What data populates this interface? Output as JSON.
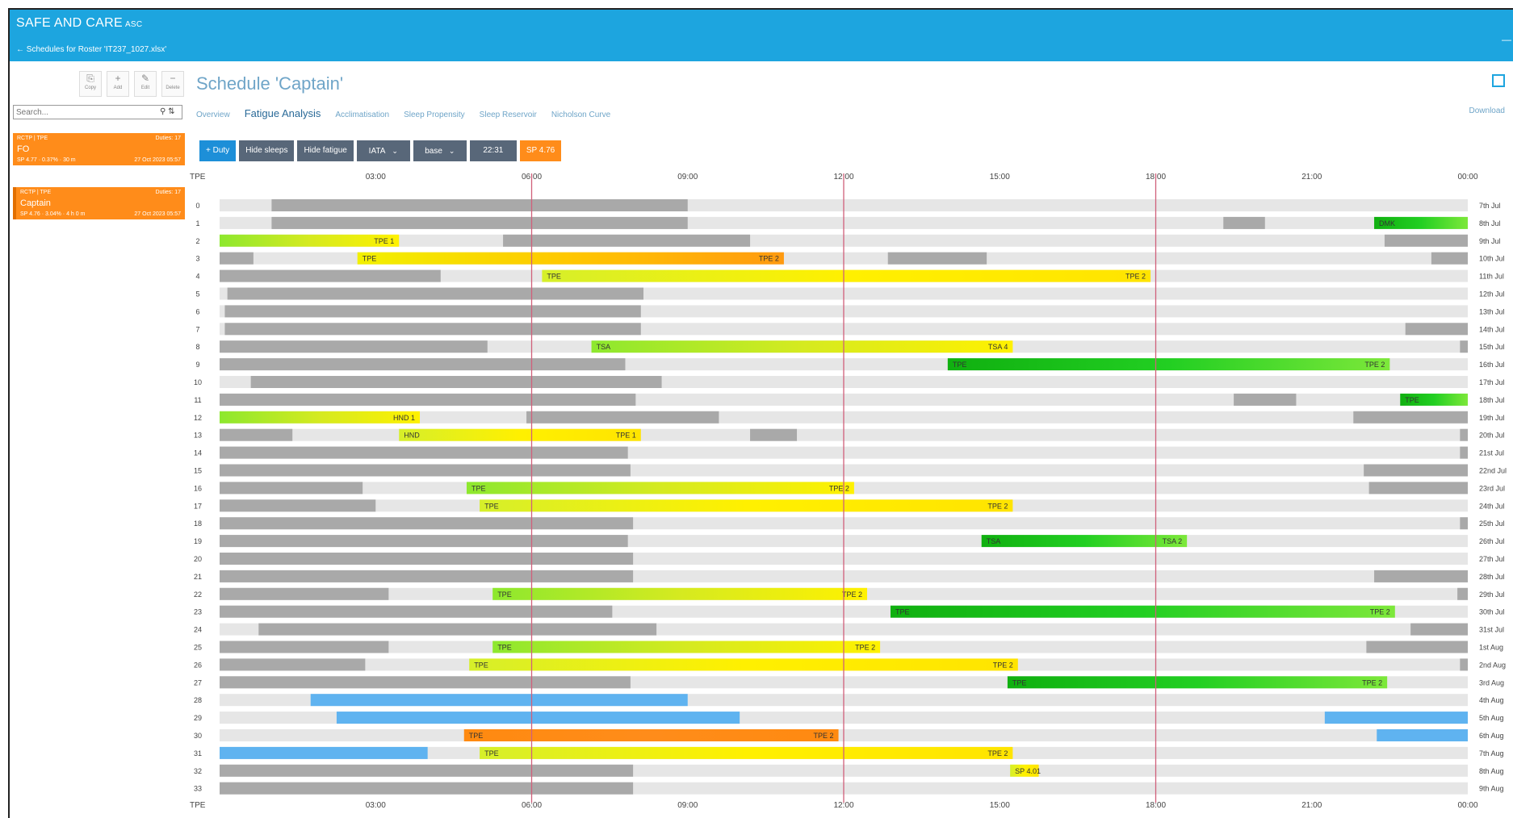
{
  "app": {
    "brand": "SAFE AND CARE",
    "brand_suffix": "ASC",
    "back_link": "← Schedules for Roster 'IT237_1027.xlsx'",
    "corner_mark": "—"
  },
  "toolbar": [
    {
      "icon": "copy-icon",
      "glyph": "⎘",
      "label": "Copy"
    },
    {
      "icon": "add-icon",
      "glyph": "+",
      "label": "Add"
    },
    {
      "icon": "edit-icon",
      "glyph": "✎",
      "label": "Edit"
    },
    {
      "icon": "delete-icon",
      "glyph": "−",
      "label": "Delete"
    }
  ],
  "search": {
    "placeholder": "Search...",
    "icon": "search-icon",
    "sort_icon": "sort-icon"
  },
  "schedules": [
    {
      "code": "RCTP | TPE",
      "duties": "Duties: 17",
      "name": "FO",
      "stats": "SP 4.77 · 0.37% · 30 m",
      "date": "27 Oct 2023 05:57"
    },
    {
      "code": "RCTP | TPE",
      "duties": "Duties: 17",
      "name": "Captain",
      "stats": "SP 4.76 · 3.04% · 4 h 0 m",
      "date": "27 Oct 2023 05:57"
    }
  ],
  "page": {
    "title": "Schedule 'Captain'",
    "download": "Download"
  },
  "tabs": [
    "Overview",
    "Fatigue Analysis",
    "Acclimatisation",
    "Sleep Propensity",
    "Sleep Reservoir",
    "Nicholson Curve"
  ],
  "controls": {
    "duty": "+ Duty",
    "hide_sleeps": "Hide sleeps",
    "hide_fatigue": "Hide fatigue",
    "iata": "IATA",
    "base": "base",
    "time": "22:31",
    "sp": "SP 4.76"
  },
  "axis": {
    "tz_label": "TPE",
    "ticks": [
      "03:00",
      "06:00",
      "09:00",
      "12:00",
      "15:00",
      "18:00",
      "21:00",
      "00:00"
    ]
  },
  "colors": {
    "brand": "#1da5df",
    "accent": "#ff8c1a",
    "sleep": "#a9a9a9",
    "rest": "#5fb3f0",
    "lane": "#e6e6e6",
    "marker": "#d0607a"
  },
  "markers_hours": [
    6,
    12,
    18
  ],
  "rows": [
    {
      "num": "0",
      "date": "7th Jul",
      "sleeps": [
        [
          1,
          9
        ]
      ],
      "duties": []
    },
    {
      "num": "1",
      "date": "8th Jul",
      "sleeps": [
        [
          1,
          9
        ],
        [
          19.3,
          20.1
        ]
      ],
      "duties": [
        {
          "s": 22.2,
          "e": 24,
          "g": "green",
          "l1": "DMK",
          "l2": ""
        }
      ]
    },
    {
      "num": "2",
      "date": "9th Jul",
      "sleeps": [
        [
          5.45,
          10.2
        ],
        [
          22.4,
          24
        ]
      ],
      "duties": [
        {
          "s": 0,
          "e": 3.45,
          "g": "gy",
          "l1": "",
          "l2": "TPE 1"
        }
      ]
    },
    {
      "num": "3",
      "date": "10th Jul",
      "sleeps": [
        [
          0,
          0.65
        ],
        [
          12.85,
          14.75
        ],
        [
          23.3,
          24
        ]
      ],
      "duties": [
        {
          "s": 2.65,
          "e": 10.85,
          "g": "yo",
          "l1": "TPE",
          "l2": "TPE 2"
        }
      ]
    },
    {
      "num": "4",
      "date": "11th Jul",
      "sleeps": [
        [
          0,
          4.25
        ]
      ],
      "duties": [
        {
          "s": 6.2,
          "e": 17.9,
          "g": "yellow",
          "l1": "TPE",
          "l2": "TPE 2"
        }
      ]
    },
    {
      "num": "5",
      "date": "12th Jul",
      "sleeps": [
        [
          0.15,
          8.15
        ]
      ],
      "duties": []
    },
    {
      "num": "6",
      "date": "13th Jul",
      "sleeps": [
        [
          0.1,
          8.1
        ]
      ],
      "duties": []
    },
    {
      "num": "7",
      "date": "14th Jul",
      "sleeps": [
        [
          0.1,
          8.1
        ],
        [
          22.8,
          24
        ]
      ],
      "duties": []
    },
    {
      "num": "8",
      "date": "15th Jul",
      "sleeps": [
        [
          0,
          5.15
        ],
        [
          23.85,
          24
        ]
      ],
      "duties": [
        {
          "s": 7.15,
          "e": 15.25,
          "g": "gy",
          "l1": "TSA",
          "l2": "TSA 4"
        }
      ]
    },
    {
      "num": "9",
      "date": "16th Jul",
      "sleeps": [
        [
          0,
          7.8
        ]
      ],
      "duties": [
        {
          "s": 14,
          "e": 22.5,
          "g": "green",
          "l1": "TPE",
          "l2": "TPE 2"
        }
      ]
    },
    {
      "num": "10",
      "date": "17th Jul",
      "sleeps": [
        [
          0.6,
          8.5
        ]
      ],
      "duties": []
    },
    {
      "num": "11",
      "date": "18th Jul",
      "sleeps": [
        [
          0,
          8
        ],
        [
          19.5,
          20.7
        ]
      ],
      "duties": [
        {
          "s": 22.7,
          "e": 24,
          "g": "green",
          "l1": "TPE",
          "l2": ""
        }
      ]
    },
    {
      "num": "12",
      "date": "19th Jul",
      "sleeps": [
        [
          5.9,
          9.6
        ],
        [
          21.8,
          24
        ]
      ],
      "duties": [
        {
          "s": 0,
          "e": 3.85,
          "g": "gy",
          "l1": "",
          "l2": "HND 1"
        }
      ]
    },
    {
      "num": "13",
      "date": "20th Jul",
      "sleeps": [
        [
          0,
          1.4
        ],
        [
          10.2,
          11.1
        ],
        [
          23.85,
          24
        ]
      ],
      "duties": [
        {
          "s": 3.45,
          "e": 8.1,
          "g": "yellow",
          "l1": "HND",
          "l2": "TPE 1"
        }
      ]
    },
    {
      "num": "14",
      "date": "21st Jul",
      "sleeps": [
        [
          0,
          7.85
        ],
        [
          23.85,
          24
        ]
      ],
      "duties": []
    },
    {
      "num": "15",
      "date": "22nd Jul",
      "sleeps": [
        [
          0,
          7.9
        ],
        [
          22,
          24
        ]
      ],
      "duties": []
    },
    {
      "num": "16",
      "date": "23rd Jul",
      "sleeps": [
        [
          0,
          2.75
        ],
        [
          22.1,
          24
        ]
      ],
      "duties": [
        {
          "s": 4.75,
          "e": 12.2,
          "g": "gy",
          "l1": "TPE",
          "l2": "TPE 2"
        }
      ]
    },
    {
      "num": "17",
      "date": "24th Jul",
      "sleeps": [
        [
          0,
          3
        ]
      ],
      "duties": [
        {
          "s": 5,
          "e": 15.25,
          "g": "yellow",
          "l1": "TPE",
          "l2": "TPE 2"
        }
      ]
    },
    {
      "num": "18",
      "date": "25th Jul",
      "sleeps": [
        [
          0,
          7.95
        ],
        [
          23.85,
          24
        ]
      ],
      "duties": []
    },
    {
      "num": "19",
      "date": "26th Jul",
      "sleeps": [
        [
          0,
          7.85
        ]
      ],
      "duties": [
        {
          "s": 14.65,
          "e": 18.6,
          "g": "green",
          "l1": "TSA",
          "l2": "TSA 2"
        }
      ]
    },
    {
      "num": "20",
      "date": "27th Jul",
      "sleeps": [
        [
          0,
          7.95
        ]
      ],
      "duties": []
    },
    {
      "num": "21",
      "date": "28th Jul",
      "sleeps": [
        [
          0,
          7.95
        ],
        [
          22.2,
          24
        ]
      ],
      "duties": []
    },
    {
      "num": "22",
      "date": "29th Jul",
      "sleeps": [
        [
          0,
          3.25
        ],
        [
          23.8,
          24
        ]
      ],
      "duties": [
        {
          "s": 5.25,
          "e": 12.45,
          "g": "gy",
          "l1": "TPE",
          "l2": "TPE 2"
        }
      ]
    },
    {
      "num": "23",
      "date": "30th Jul",
      "sleeps": [
        [
          0,
          7.55
        ]
      ],
      "duties": [
        {
          "s": 12.9,
          "e": 22.6,
          "g": "green",
          "l1": "TPE",
          "l2": "TPE 2"
        }
      ]
    },
    {
      "num": "24",
      "date": "31st Jul",
      "sleeps": [
        [
          0.75,
          8.4
        ],
        [
          22.9,
          24
        ]
      ],
      "duties": []
    },
    {
      "num": "25",
      "date": "1st Aug",
      "sleeps": [
        [
          0,
          3.25
        ],
        [
          22.05,
          24
        ]
      ],
      "duties": [
        {
          "s": 5.25,
          "e": 12.7,
          "g": "gy",
          "l1": "TPE",
          "l2": "TPE 2"
        }
      ]
    },
    {
      "num": "26",
      "date": "2nd Aug",
      "sleeps": [
        [
          0,
          2.8
        ],
        [
          23.85,
          24
        ]
      ],
      "duties": [
        {
          "s": 4.8,
          "e": 15.35,
          "g": "yellow",
          "l1": "TPE",
          "l2": "TPE 2"
        }
      ]
    },
    {
      "num": "27",
      "date": "3rd Aug",
      "sleeps": [
        [
          0,
          7.9
        ]
      ],
      "duties": [
        {
          "s": 15.15,
          "e": 22.45,
          "g": "green",
          "l1": "TPE",
          "l2": "TPE 2"
        }
      ]
    },
    {
      "num": "28",
      "date": "4th Aug",
      "sleeps": [],
      "rest": [
        [
          1.75,
          9
        ]
      ],
      "duties": []
    },
    {
      "num": "29",
      "date": "5th Aug",
      "sleeps": [],
      "rest": [
        [
          2.25,
          10
        ],
        [
          21.25,
          24
        ]
      ],
      "duties": []
    },
    {
      "num": "30",
      "date": "6th Aug",
      "sleeps": [],
      "rest": [
        [
          22.25,
          24
        ]
      ],
      "duties": [
        {
          "s": 4.7,
          "e": 11.9,
          "g": "orange",
          "l1": "TPE",
          "l2": "TPE 2"
        }
      ]
    },
    {
      "num": "31",
      "date": "7th Aug",
      "sleeps": [],
      "rest": [
        [
          0,
          4
        ]
      ],
      "duties": [
        {
          "s": 5,
          "e": 15.25,
          "g": "yellow",
          "l1": "TPE",
          "l2": "TPE 2"
        }
      ]
    },
    {
      "num": "32",
      "date": "8th Aug",
      "sleeps": [
        [
          0,
          7.95
        ]
      ],
      "duties": [
        {
          "s": 15.2,
          "e": 15.75,
          "g": "yellow",
          "l1": "SP 4.01",
          "l2": ""
        }
      ]
    },
    {
      "num": "33",
      "date": "9th Aug",
      "sleeps": [
        [
          0,
          7.95
        ]
      ],
      "duties": []
    }
  ]
}
